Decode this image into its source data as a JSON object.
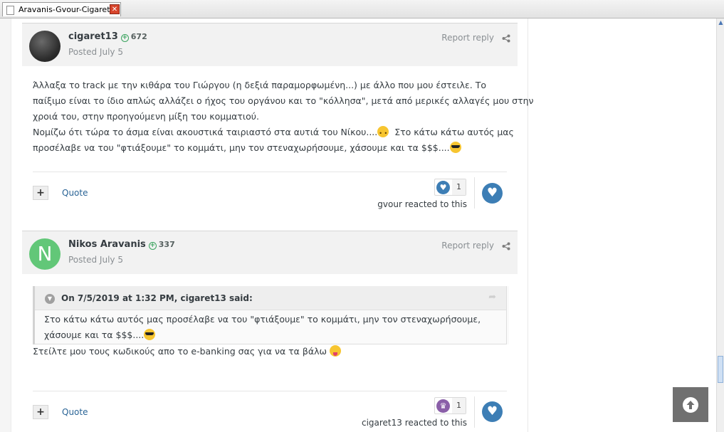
{
  "browser": {
    "tab_title": "Aravanis-Gvour-Cigaret...",
    "tab_close": "✕"
  },
  "icons": {
    "share": "share-icon",
    "multiquote": "plus-icon",
    "like_reaction": "heart-icon",
    "thanks_reaction": "trophy-icon",
    "react_button": "heart-icon",
    "scroll_top": "arrow-up-icon",
    "quote_toggle": "chevron-down-icon",
    "goto_quote": "arrow-right-icon"
  },
  "colors": {
    "accent_link": "#2a6496",
    "reaction_blue": "#3d7eb5",
    "reaction_purple": "#8a5fa8",
    "avatar_green": "#62c778",
    "reputation_green": "#3aa35e"
  },
  "posts": [
    {
      "author": "cigaret13",
      "reputation": "672",
      "date": "Posted July 5",
      "report": "Report reply",
      "lines": [
        " Άλλαξα το track με την κιθάρα του Γιώργου (η δεξιά παραμορφωμένη...) με άλλο που μου έστειλε. Το",
        "παίξιμο είναι το ίδιο απλώς αλλάζει ο ήχος του οργάνου και το \"κόλλησα\", μετά από μερικές αλλαγές μου στην",
        "χροιά του, στην προηγούμενη μίξη του κομματιού.",
        " Νομίζω ότι τώρα το άσμα είναι ακουστικά ταιριαστό στα αυτιά του Νίκου....",
        "  Στο κάτω κάτω αυτός μας",
        "προσέλαβε να του \"φτιάξουμε\" το κομμάτι, μην τον στεναχωρήσουμε, χάσουμε και τα $$$...."
      ],
      "quote_label": "Quote",
      "multiquote": "+",
      "reaction_count": "1",
      "reacted_by": "gvour reacted to this"
    },
    {
      "author": "Nikos Aravanis",
      "avatar_letter": "N",
      "reputation": "337",
      "date": "Posted July 5",
      "report": "Report reply",
      "quote_cite": "On 7/5/2019 at 1:32 PM, cigaret13 said:",
      "quote_lines": [
        "Στο κάτω κάτω αυτός μας προσέλαβε να του \"φτιάξουμε\" το κομμάτι, μην τον στεναχωρήσουμε,",
        "χάσουμε και τα $$$...."
      ],
      "text": "Στείλτε μου τους κωδικούς απο το e-banking σας για να τα βάλω",
      "quote_label": "Quote",
      "multiquote": "+",
      "reaction_count": "1",
      "reacted_by": "cigaret13 reacted to this"
    }
  ]
}
